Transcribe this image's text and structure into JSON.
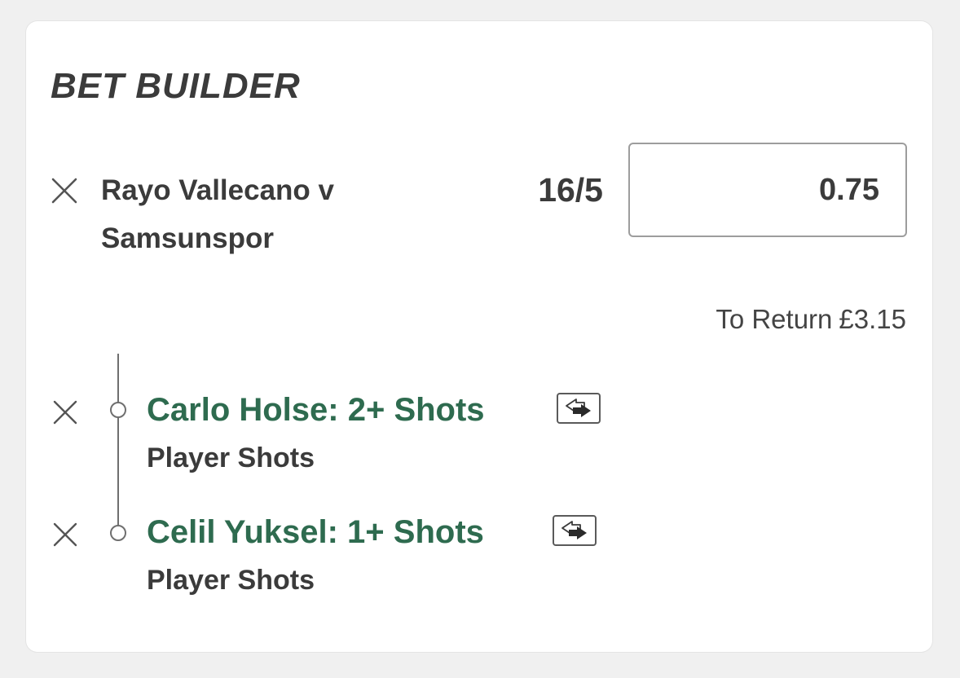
{
  "header": {
    "title": "BET BUILDER"
  },
  "bet": {
    "match_line1": "Rayo Vallecano v",
    "match_line2": "Samsunspor",
    "odds": "16/5",
    "stake_value": "0.75",
    "to_return_label": "To Return",
    "to_return_value": "£3.15"
  },
  "selections": [
    {
      "name": "Carlo Holse: 2+ Shots",
      "market": "Player Shots"
    },
    {
      "name": "Celil Yuksel: 1+ Shots",
      "market": "Player Shots"
    }
  ],
  "icons": {
    "remove": "close-icon",
    "swap": "swap-arrows-icon"
  },
  "colors": {
    "selection_green": "#2e6b4f",
    "text_dark": "#3b3b3b",
    "background": "#f0f0f0"
  }
}
